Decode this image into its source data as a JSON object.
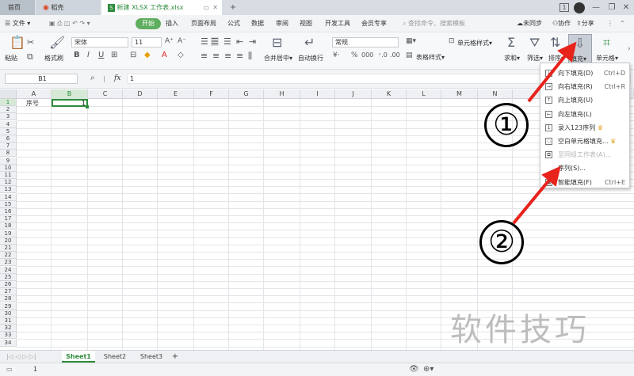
{
  "tabbar": {
    "home_tab": "首页",
    "doc_tab1": "稻壳",
    "doc_tab2": "新建 XLSX 工作表.xlsx",
    "add_tab": "+",
    "controls": [
      "1",
      "—",
      "❐",
      "✕"
    ]
  },
  "menubar": {
    "file_menu": "文件",
    "items": [
      "开始",
      "插入",
      "页面布局",
      "公式",
      "数据",
      "审阅",
      "视图",
      "开发工具",
      "会员专享"
    ],
    "search_placeholder": "查找命令、搜索模板",
    "sync": "未同步",
    "collab": "协作",
    "share": "分享"
  },
  "ribbon": {
    "paste": "粘贴",
    "format_painter": "格式刷",
    "font_name": "宋体",
    "font_size": "11",
    "merge_center": "合并居中",
    "wrap_text": "自动换行",
    "number_format": "常规",
    "table_style": "表格样式",
    "cell_style": "单元格样式",
    "sum": "求和",
    "filter": "筛选",
    "sort": "排序",
    "fill": "填充",
    "cell": "单元格"
  },
  "formula_bar": {
    "name_box": "B1",
    "fx": "fx",
    "value": "1"
  },
  "sheet": {
    "columns": [
      "A",
      "B",
      "C",
      "D",
      "E",
      "F",
      "G",
      "H",
      "I",
      "J",
      "K",
      "L",
      "M",
      "N"
    ],
    "rows": [
      "1",
      "2",
      "3",
      "4",
      "5",
      "6",
      "7",
      "8",
      "9",
      "10",
      "11",
      "12",
      "13",
      "14",
      "15",
      "16",
      "17",
      "18",
      "19",
      "20",
      "21",
      "22",
      "23",
      "24",
      "25",
      "26",
      "27",
      "28",
      "29",
      "30",
      "31",
      "32",
      "33",
      "34"
    ],
    "cell_a1": "序号",
    "cell_b1": "1"
  },
  "sheet_tabs": {
    "tabs": [
      "Sheet1",
      "Sheet2",
      "Sheet3"
    ],
    "add": "+"
  },
  "statusbar": {
    "value": "1"
  },
  "fill_dropdown": {
    "items": [
      {
        "label": "向下填充(D)",
        "shortcut": "Ctrl+D",
        "disabled": false
      },
      {
        "label": "向右填充(R)",
        "shortcut": "Ctrl+R",
        "disabled": false
      },
      {
        "label": "向上填充(U)",
        "shortcut": "",
        "disabled": false
      },
      {
        "label": "向左填充(L)",
        "shortcut": "",
        "disabled": false
      },
      {
        "label": "录入123序列",
        "shortcut": "",
        "disabled": false
      },
      {
        "label": "空白单元格填充...",
        "shortcut": "",
        "disabled": false
      },
      {
        "label": "至同组工作表(A)...",
        "shortcut": "",
        "disabled": true
      },
      {
        "label": "序列(S)...",
        "shortcut": "",
        "disabled": false
      },
      {
        "label": "智能填充(F)",
        "shortcut": "Ctrl+E",
        "disabled": false
      }
    ]
  },
  "annotations": {
    "step1": "①",
    "step2": "②",
    "arrow_color": "#e8231c",
    "watermark": "软件技巧"
  },
  "colors": {
    "accent_green": "#5fae5f",
    "selection_green": "#2c8b3c"
  }
}
